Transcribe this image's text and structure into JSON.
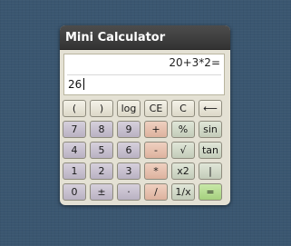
{
  "window": {
    "title": "Mini Calculator"
  },
  "display": {
    "expression": "20+3*2=",
    "input_value": "26"
  },
  "keys": [
    {
      "label": "(",
      "name": "key-open-paren",
      "kind": "fn"
    },
    {
      "label": ")",
      "name": "key-close-paren",
      "kind": "fn"
    },
    {
      "label": "log",
      "name": "key-log",
      "kind": "fn"
    },
    {
      "label": "CE",
      "name": "key-clear-entry",
      "kind": "fn"
    },
    {
      "label": "C",
      "name": "key-clear",
      "kind": "fn"
    },
    {
      "label": "⟵",
      "name": "key-backspace",
      "kind": "fn"
    },
    {
      "label": "7",
      "name": "key-7",
      "kind": "num"
    },
    {
      "label": "8",
      "name": "key-8",
      "kind": "num"
    },
    {
      "label": "9",
      "name": "key-9",
      "kind": "num"
    },
    {
      "label": "+",
      "name": "key-plus",
      "kind": "op"
    },
    {
      "label": "%",
      "name": "key-percent",
      "kind": "sci"
    },
    {
      "label": "sin",
      "name": "key-sin",
      "kind": "sci"
    },
    {
      "label": "4",
      "name": "key-4",
      "kind": "num"
    },
    {
      "label": "5",
      "name": "key-5",
      "kind": "num"
    },
    {
      "label": "6",
      "name": "key-6",
      "kind": "num"
    },
    {
      "label": "-",
      "name": "key-minus",
      "kind": "op"
    },
    {
      "label": "√",
      "name": "key-sqrt",
      "kind": "sci"
    },
    {
      "label": "tan",
      "name": "key-tan",
      "kind": "sci"
    },
    {
      "label": "1",
      "name": "key-1",
      "kind": "num"
    },
    {
      "label": "2",
      "name": "key-2",
      "kind": "num"
    },
    {
      "label": "3",
      "name": "key-3",
      "kind": "num"
    },
    {
      "label": "*",
      "name": "key-multiply",
      "kind": "op"
    },
    {
      "label": "x2",
      "name": "key-square",
      "kind": "sci"
    },
    {
      "label": "|",
      "name": "key-abs",
      "kind": "sci"
    },
    {
      "label": "0",
      "name": "key-0",
      "kind": "num"
    },
    {
      "label": "±",
      "name": "key-plus-minus",
      "kind": "num"
    },
    {
      "label": "·",
      "name": "key-decimal",
      "kind": "num"
    },
    {
      "label": "/",
      "name": "key-divide",
      "kind": "op"
    },
    {
      "label": "1/x",
      "name": "key-reciprocal",
      "kind": "sci"
    },
    {
      "label": "=",
      "name": "key-equals",
      "kind": "eq"
    }
  ],
  "colors": {
    "desktop": "#3a5670",
    "titlebar": "#3d3d3d",
    "body": "#e4e1d4",
    "number_key": "#c4bdcc",
    "operator_key": "#e4bda9",
    "function_key": "#e6e3d6",
    "scientific_key": "#cdd5c4",
    "equals_key": "#b3da8e"
  }
}
